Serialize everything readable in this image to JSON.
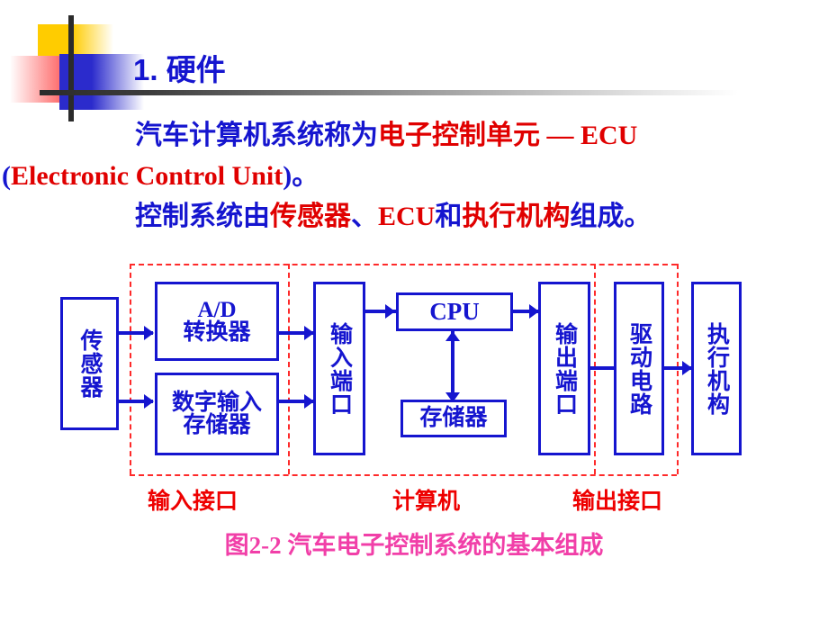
{
  "slide": {
    "title": "1. 硬件",
    "accent_blue": "#1515cf",
    "accent_red": "#e00000",
    "accent_magenta": "#f13fa8",
    "deco_yellow": "#ffcc00",
    "deco_red": "#fe1f1f",
    "deco_blue": "#2b2bcc"
  },
  "body": {
    "line1_a": "汽车计算机系统称为",
    "line1_b": "电子控制单元 — ECU",
    "line2_a": "(",
    "line2_b": "Electronic Control Unit",
    "line2_c": ")。",
    "line3_a": "控制系统由",
    "line3_b": "传感器",
    "line3_c": "、",
    "line3_d": "ECU",
    "line3_e": "和",
    "line3_f": "执行机构",
    "line3_g": "组成。"
  },
  "diagram": {
    "boxes": [
      {
        "id": "sensor",
        "label": "传感器",
        "orientation": "vertical"
      },
      {
        "id": "ad-converter",
        "label": "A/D\n转换器",
        "orientation": "horizontal"
      },
      {
        "id": "digital-input",
        "label": "数字输入\n存储器",
        "orientation": "horizontal"
      },
      {
        "id": "input-port",
        "label": "输入端口",
        "orientation": "vertical"
      },
      {
        "id": "cpu",
        "label": "CPU",
        "orientation": "horizontal"
      },
      {
        "id": "memory",
        "label": "存储器",
        "orientation": "horizontal"
      },
      {
        "id": "output-port",
        "label": "输出端口",
        "orientation": "vertical"
      },
      {
        "id": "drive-circuit",
        "label": "驱动电路",
        "orientation": "vertical"
      },
      {
        "id": "actuator",
        "label": "执行机构",
        "orientation": "vertical"
      }
    ],
    "box_text": {
      "sensor": "传感器",
      "ad_line1": "A/D",
      "ad_line2": "转换器",
      "digital_line1": "数字输入",
      "digital_line2": "存储器",
      "input_port": "输入端口",
      "cpu": "CPU",
      "memory": "存储器",
      "output_port": "输出端口",
      "drive_circuit": "驱动电路",
      "actuator": "执行机构"
    },
    "zone_labels": {
      "input_interface": "输入接口",
      "computer": "计算机",
      "output_interface": "输出接口"
    },
    "caption": "图2-2  汽车电子控制系统的基本组成"
  }
}
